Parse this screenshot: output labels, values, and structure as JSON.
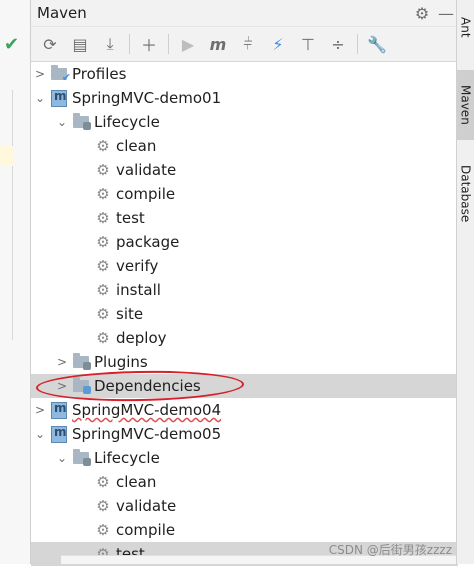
{
  "panel": {
    "title": "Maven"
  },
  "tree": {
    "profiles": "Profiles",
    "demo01": "SpringMVC-demo01",
    "lifecycle": "Lifecycle",
    "goals": [
      "clean",
      "validate",
      "compile",
      "test",
      "package",
      "verify",
      "install",
      "site",
      "deploy"
    ],
    "plugins": "Plugins",
    "dependencies": "Dependencies",
    "demo04": "SpringMVC-demo04",
    "demo05": "SpringMVC-demo05",
    "lifecycle2": "Lifecycle",
    "goals2": [
      "clean",
      "validate",
      "compile",
      "test"
    ]
  },
  "side_tabs": {
    "ant": "Ant",
    "maven": "Maven",
    "database": "Database"
  },
  "watermark": "CSDN @后街男孩zzzz",
  "colors": {
    "selection": "#d6d6d6",
    "ellipse": "#d6202b",
    "accent": "#3d8ee8"
  },
  "icons": [
    "refresh-icon",
    "add-folder-icon",
    "download-icon",
    "plus-icon",
    "run-icon",
    "maven-goal-icon",
    "toggle-offline-icon",
    "lightning-icon",
    "show-dependencies-icon",
    "collapse-icon",
    "settings-wrench-icon",
    "gear-icon",
    "minimize-icon"
  ]
}
